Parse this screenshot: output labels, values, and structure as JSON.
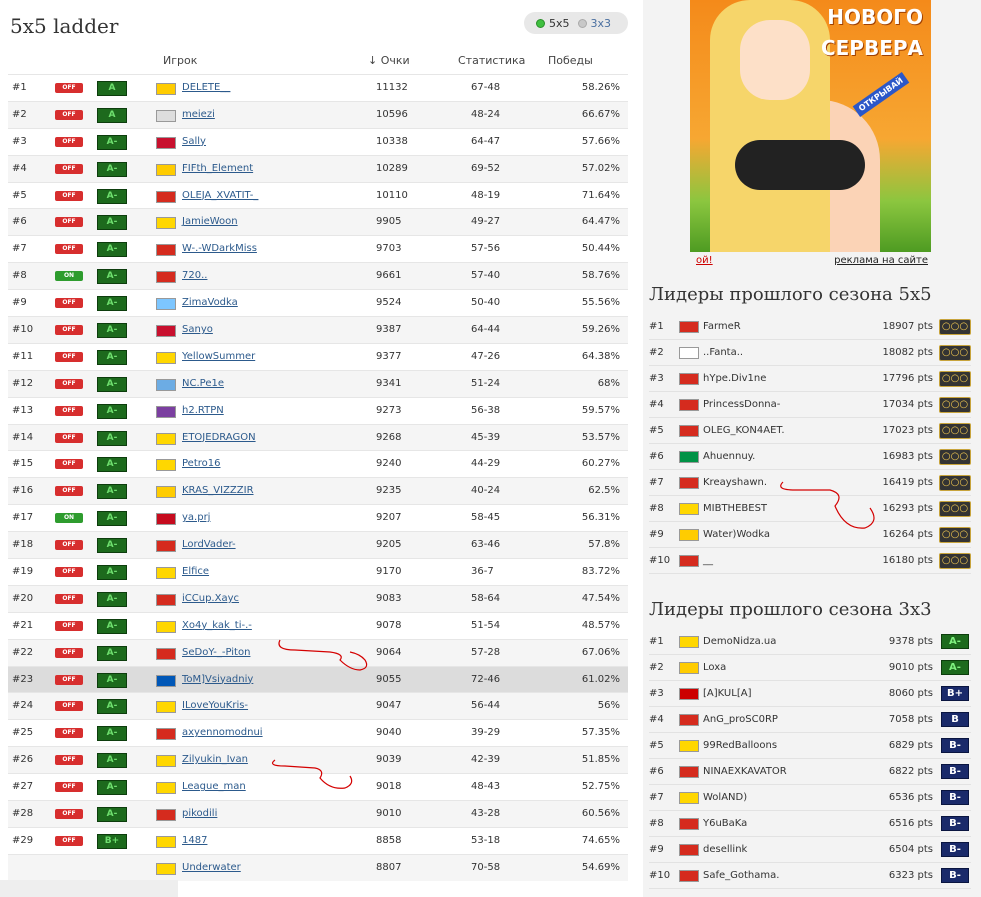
{
  "page": {
    "title": "5x5 ladder"
  },
  "mode_switch": {
    "options": [
      {
        "label": "5x5",
        "active": true
      },
      {
        "label": "3x3",
        "active": false
      }
    ]
  },
  "table": {
    "columns": {
      "player": "Игрок",
      "points": "↓ Очки",
      "stats": "Статистика",
      "wins": "Победы"
    },
    "rows": [
      {
        "rank": "#1",
        "status": "OFF",
        "level": "A",
        "player": "DELETE__",
        "points": "11132",
        "stats": "67-48",
        "wins": "58.26%"
      },
      {
        "rank": "#2",
        "status": "OFF",
        "level": "A",
        "player": "meiezi",
        "points": "10596",
        "stats": "48-24",
        "wins": "66.67%"
      },
      {
        "rank": "#3",
        "status": "OFF",
        "level": "A-",
        "player": "Sally",
        "points": "10338",
        "stats": "64-47",
        "wins": "57.66%"
      },
      {
        "rank": "#4",
        "status": "OFF",
        "level": "A-",
        "player": "FIFth_Element",
        "points": "10289",
        "stats": "69-52",
        "wins": "57.02%"
      },
      {
        "rank": "#5",
        "status": "OFF",
        "level": "A-",
        "player": "OLEJA_XVATIT-_",
        "points": "10110",
        "stats": "48-19",
        "wins": "71.64%"
      },
      {
        "rank": "#6",
        "status": "OFF",
        "level": "A-",
        "player": "JamieWoon",
        "points": "9905",
        "stats": "49-27",
        "wins": "64.47%"
      },
      {
        "rank": "#7",
        "status": "OFF",
        "level": "A-",
        "player": "W-.-WDarkMiss",
        "points": "9703",
        "stats": "57-56",
        "wins": "50.44%"
      },
      {
        "rank": "#8",
        "status": "ON",
        "level": "A-",
        "player": "720..",
        "points": "9661",
        "stats": "57-40",
        "wins": "58.76%"
      },
      {
        "rank": "#9",
        "status": "OFF",
        "level": "A-",
        "player": "ZimaVodka",
        "points": "9524",
        "stats": "50-40",
        "wins": "55.56%"
      },
      {
        "rank": "#10",
        "status": "OFF",
        "level": "A-",
        "player": "Sanyo",
        "points": "9387",
        "stats": "64-44",
        "wins": "59.26%"
      },
      {
        "rank": "#11",
        "status": "OFF",
        "level": "A-",
        "player": "YellowSummer",
        "points": "9377",
        "stats": "47-26",
        "wins": "64.38%"
      },
      {
        "rank": "#12",
        "status": "OFF",
        "level": "A-",
        "player": "NC.Pe1e",
        "points": "9341",
        "stats": "51-24",
        "wins": "68%"
      },
      {
        "rank": "#13",
        "status": "OFF",
        "level": "A-",
        "player": "h2.RTPN",
        "points": "9273",
        "stats": "56-38",
        "wins": "59.57%"
      },
      {
        "rank": "#14",
        "status": "OFF",
        "level": "A-",
        "player": "ETOJEDRAGON",
        "points": "9268",
        "stats": "45-39",
        "wins": "53.57%"
      },
      {
        "rank": "#15",
        "status": "OFF",
        "level": "A-",
        "player": "Petro16",
        "points": "9240",
        "stats": "44-29",
        "wins": "60.27%"
      },
      {
        "rank": "#16",
        "status": "OFF",
        "level": "A-",
        "player": "KRAS_VIZZZIR",
        "points": "9235",
        "stats": "40-24",
        "wins": "62.5%"
      },
      {
        "rank": "#17",
        "status": "ON",
        "level": "A-",
        "player": "ya.prj",
        "points": "9207",
        "stats": "58-45",
        "wins": "56.31%"
      },
      {
        "rank": "#18",
        "status": "OFF",
        "level": "A-",
        "player": "LordVader-",
        "points": "9205",
        "stats": "63-46",
        "wins": "57.8%"
      },
      {
        "rank": "#19",
        "status": "OFF",
        "level": "A-",
        "player": "Elfice",
        "points": "9170",
        "stats": "36-7",
        "wins": "83.72%"
      },
      {
        "rank": "#20",
        "status": "OFF",
        "level": "A-",
        "player": "iCCup.Xayc",
        "points": "9083",
        "stats": "58-64",
        "wins": "47.54%"
      },
      {
        "rank": "#21",
        "status": "OFF",
        "level": "A-",
        "player": "Xo4y_kak_ti-.-",
        "points": "9078",
        "stats": "51-54",
        "wins": "48.57%"
      },
      {
        "rank": "#22",
        "status": "OFF",
        "level": "A-",
        "player": "SeDoY-_-Piton",
        "points": "9064",
        "stats": "57-28",
        "wins": "67.06%"
      },
      {
        "rank": "#23",
        "status": "OFF",
        "level": "A-",
        "player": "ToM]Vsiyadniy",
        "points": "9055",
        "stats": "72-46",
        "wins": "61.02%"
      },
      {
        "rank": "#24",
        "status": "OFF",
        "level": "A-",
        "player": "ILoveYouKris-",
        "points": "9047",
        "stats": "56-44",
        "wins": "56%"
      },
      {
        "rank": "#25",
        "status": "OFF",
        "level": "A-",
        "player": "axyennomodnui",
        "points": "9040",
        "stats": "39-29",
        "wins": "57.35%"
      },
      {
        "rank": "#26",
        "status": "OFF",
        "level": "A-",
        "player": "Zilyukin_Ivan",
        "points": "9039",
        "stats": "42-39",
        "wins": "51.85%"
      },
      {
        "rank": "#27",
        "status": "OFF",
        "level": "A-",
        "player": "League_man",
        "points": "9018",
        "stats": "48-43",
        "wins": "52.75%"
      },
      {
        "rank": "#28",
        "status": "OFF",
        "level": "A-",
        "player": "pikodili",
        "points": "9010",
        "stats": "43-28",
        "wins": "60.56%"
      },
      {
        "rank": "#29",
        "status": "OFF",
        "level": "B+",
        "player": "1487",
        "points": "8858",
        "stats": "53-18",
        "wins": "74.65%"
      },
      {
        "rank": "",
        "status": "",
        "level": "",
        "player": "Underwater",
        "points": "8807",
        "stats": "70-58",
        "wins": "54.69%"
      }
    ]
  },
  "ad": {
    "headline_1": "НОВОГО",
    "headline_2": "СЕРВЕРА",
    "badge": "ОТКРЫВАЙ",
    "link_left": "ой!",
    "link_right": "реклама на сайте"
  },
  "season5": {
    "title": "Лидеры прошлого сезона 5x5",
    "rows": [
      {
        "rank": "#1",
        "player": "FarmeR",
        "pts": "18907 pts"
      },
      {
        "rank": "#2",
        "player": "..Fanta..",
        "pts": "18082 pts"
      },
      {
        "rank": "#3",
        "player": "hYpe.Div1ne",
        "pts": "17796 pts"
      },
      {
        "rank": "#4",
        "player": "PrincessDonna-",
        "pts": "17034 pts"
      },
      {
        "rank": "#5",
        "player": "OLEG_KON4AET.",
        "pts": "17023 pts"
      },
      {
        "rank": "#6",
        "player": "Ahuennuy.",
        "pts": "16983 pts"
      },
      {
        "rank": "#7",
        "player": "Kreayshawn.",
        "pts": "16419 pts"
      },
      {
        "rank": "#8",
        "player": "MIBTHEBEST",
        "pts": "16293 pts"
      },
      {
        "rank": "#9",
        "player": "Water)Wodka",
        "pts": "16264 pts"
      },
      {
        "rank": "#10",
        "player": "__",
        "pts": "16180 pts"
      }
    ]
  },
  "season3": {
    "title": "Лидеры прошлого сезона 3x3",
    "rows": [
      {
        "rank": "#1",
        "player": "DemoNidza.ua",
        "pts": "9378 pts",
        "level": "A-"
      },
      {
        "rank": "#2",
        "player": "Loxa",
        "pts": "9010 pts",
        "level": "A-"
      },
      {
        "rank": "#3",
        "player": "[A]KUL[A]",
        "pts": "8060 pts",
        "level": "B+"
      },
      {
        "rank": "#4",
        "player": "AnG_proSC0RP",
        "pts": "7058 pts",
        "level": "B"
      },
      {
        "rank": "#5",
        "player": "99RedBalloons",
        "pts": "6829 pts",
        "level": "B-"
      },
      {
        "rank": "#6",
        "player": "NINAEXKAVATOR",
        "pts": "6822 pts",
        "level": "B-"
      },
      {
        "rank": "#7",
        "player": "WolAND)",
        "pts": "6536 pts",
        "level": "B-"
      },
      {
        "rank": "#8",
        "player": "Y6uBaKa",
        "pts": "6516 pts",
        "level": "B-"
      },
      {
        "rank": "#9",
        "player": "desellink",
        "pts": "6504 pts",
        "level": "B-"
      },
      {
        "rank": "#10",
        "player": "Safe_Gothama.",
        "pts": "6323 pts",
        "level": "B-"
      }
    ]
  },
  "colors": {
    "off": "#d72e2e",
    "on": "#2e9c2e",
    "link": "#2c5a8c"
  }
}
